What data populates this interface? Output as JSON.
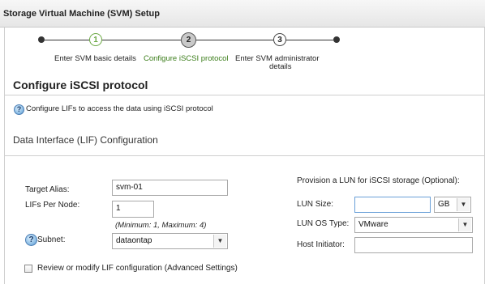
{
  "window": {
    "title": "Storage Virtual Machine (SVM) Setup"
  },
  "wizard": {
    "steps": [
      {
        "number": "1",
        "label": "Enter SVM basic details",
        "state": "done"
      },
      {
        "number": "2",
        "label": "Configure iSCSI protocol",
        "state": "active"
      },
      {
        "number": "3",
        "label": "Enter SVM administrator details",
        "label_line1": "Enter SVM administrator",
        "label_line2": "details",
        "state": "pending"
      }
    ]
  },
  "page": {
    "title": "Configure iSCSI protocol",
    "help_text": "Configure LIFs to access the data using iSCSI protocol",
    "section_title": "Data Interface (LIF) Configuration"
  },
  "lif_form": {
    "target_alias_label": "Target Alias:",
    "target_alias_value": "svm-01",
    "lifs_per_node_label": "LIFs Per Node:",
    "lifs_per_node_value": "1",
    "lifs_hint": "(Minimum: 1, Maximum: 4)",
    "subnet_label": "Subnet:",
    "subnet_value": "dataontap",
    "review_label": "Review or modify LIF configuration (Advanced Settings)",
    "review_checked": false
  },
  "lun_form": {
    "heading": "Provision a LUN for iSCSI storage (Optional):",
    "size_label": "LUN Size:",
    "size_value": "",
    "size_unit": "GB",
    "os_type_label": "LUN OS Type:",
    "os_type_value": "VMware",
    "initiator_label": "Host Initiator:",
    "initiator_value": ""
  },
  "colors": {
    "done": "#6aa842",
    "current_text": "#3b7d1a",
    "focus_border": "#6aa0d8"
  }
}
